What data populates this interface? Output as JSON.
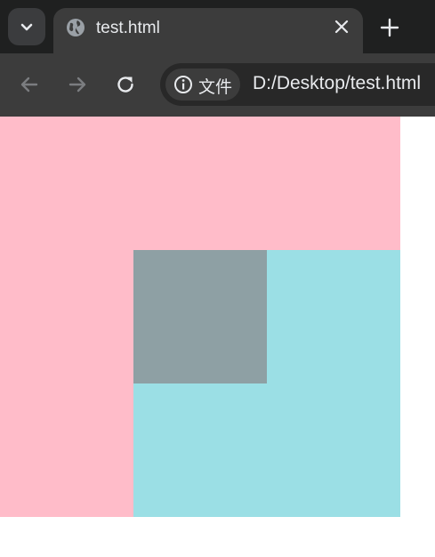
{
  "browser": {
    "tab": {
      "title": "test.html",
      "favicon": "globe-icon"
    },
    "site_info": {
      "label": "文件",
      "icon": "info-icon"
    },
    "address_bar": {
      "url": "D:/Desktop/test.html"
    },
    "icons": {
      "tab_menu": "chevron-down-icon",
      "close": "close-icon",
      "new_tab": "plus-icon",
      "back": "back-arrow-icon",
      "forward": "forward-arrow-icon",
      "reload": "reload-icon"
    }
  },
  "page": {
    "colors": {
      "pink_box": "#ffbcc9",
      "cyan_box": "#9bdfe5",
      "gray_box": "#8ea0a4",
      "background": "#ffffff"
    }
  }
}
